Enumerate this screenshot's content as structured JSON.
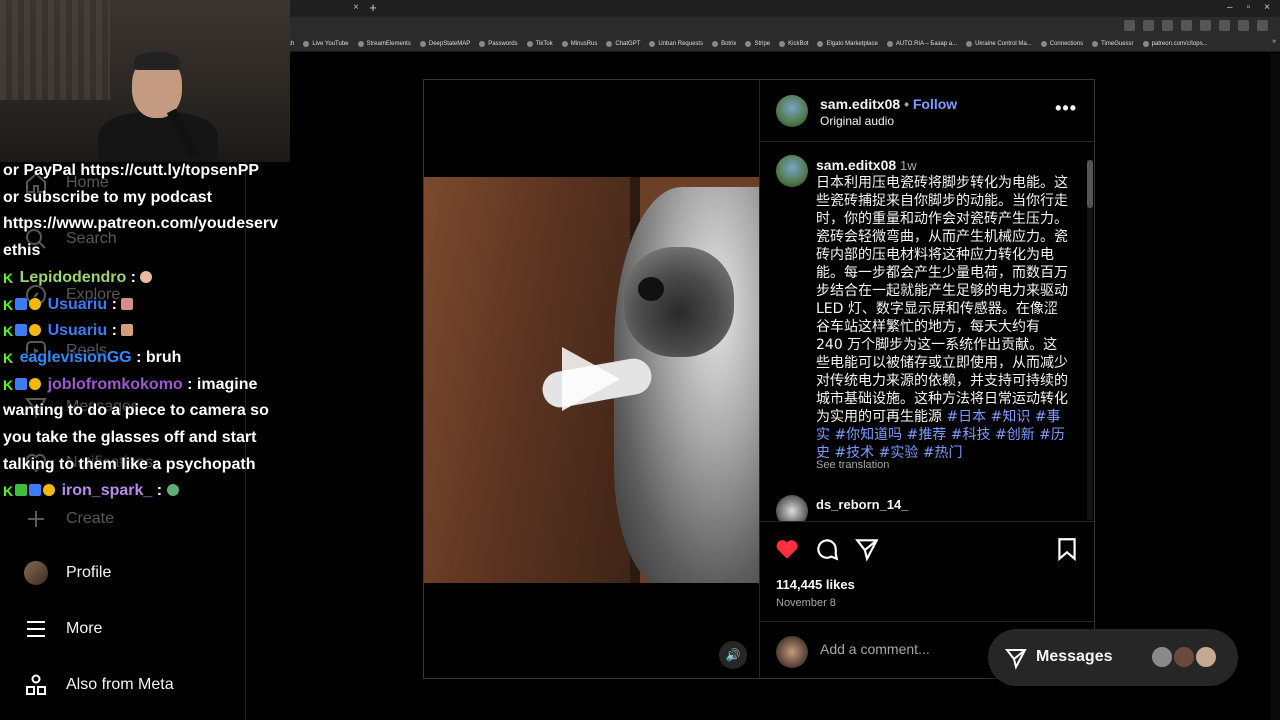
{
  "browser": {
    "tab_close": "×",
    "tab_new": "+",
    "window_controls": [
      "–",
      "▫",
      "×"
    ],
    "bookmarks": [
      "ch",
      "Live YouTube",
      "StreamElements",
      "DeepStateMAP",
      "Passwords",
      "TikTok",
      "MinusRus",
      "ChatGPT",
      "Unban Requests",
      "Botrix",
      "Stripe",
      "KickBot",
      "Elgato Marketplace",
      "AUTO.RIA – Базар а...",
      "Ukraine Control Ma...",
      "Connections",
      "TimeGuessr",
      "patreon.com/c/tops..."
    ],
    "bookmarks_overflow": "»"
  },
  "sidebar": {
    "items": [
      {
        "label": "Home",
        "icon": "home-icon"
      },
      {
        "label": "Search",
        "icon": "search-icon"
      },
      {
        "label": "Explore",
        "icon": "compass-icon"
      },
      {
        "label": "Reels",
        "icon": "reels-icon"
      },
      {
        "label": "Messages",
        "icon": "send-icon"
      },
      {
        "label": "Notifications",
        "icon": "heart-icon"
      },
      {
        "label": "Create",
        "icon": "plus-icon"
      },
      {
        "label": "Profile",
        "icon": "avatar"
      },
      {
        "label": "More",
        "icon": "hamburger-icon"
      },
      {
        "label": "Also from Meta",
        "icon": "grid-icon"
      }
    ]
  },
  "chat": {
    "lines": [
      {
        "text": "or PayPal https://cutt.ly/topsenPP"
      },
      {
        "text": "or subscribe to my podcast"
      },
      {
        "text": "https://www.patreon.com/youdeserv"
      },
      {
        "text": "ethis"
      }
    ],
    "messages": [
      {
        "user": "Lepidodendro",
        "user_color": "#9ad66b",
        "text": " : "
      },
      {
        "user": "Usuariu",
        "user_color": "#3d7cf5",
        "text": " : "
      },
      {
        "user": "Usuariu",
        "user_color": "#3d7cf5",
        "text": " : "
      },
      {
        "user": "eaglevisionGG",
        "user_color": "#2e8bff",
        "text": " : bruh"
      },
      {
        "user": "joblofromkokomo",
        "user_color": "#9b59d0",
        "text": " : imagine"
      },
      {
        "user": "iron_spark_",
        "user_color": "#b58ce8",
        "text": " : "
      }
    ],
    "wrap_lines": [
      "wanting to do a piece to camera so",
      "you take the glasses off and start",
      "talking to them like a psychopath"
    ],
    "badge_letter": "K"
  },
  "post": {
    "author": "sam.editx08",
    "separator": "•",
    "follow_label": "Follow",
    "audio": "Original audio",
    "more": "•••",
    "caption_time": "1w",
    "caption_text": "日本利用压电瓷砖将脚步转化为电能。这些瓷砖捕捉来自你脚步的动能。当你行走时，你的重量和动作会对瓷砖产生压力。瓷砖会轻微弯曲，从而产生机械应力。瓷砖内部的压电材料将这种应力转化为电能。每一步都会产生少量电荷，而数百万步结合在一起就能产生足够的电力来驱动 LED 灯、数字显示屏和传感器。在像涩谷车站这样繁忙的地方，每天大约有 240 万个脚步为这一系统作出贡献。这些电能可以被储存或立即使用，从而减少对传统电力来源的依赖，并支持可持续的城市基础设施。这种方法将日常运动转化为实用的可再生能源",
    "hashtags": " #日本 #知识 #事实 #你知道吗 #推荐 #科技 #创新 #历史 #技术 #实验 #热门",
    "see_translation": "See translation",
    "comment_user": "ds_reborn_14_",
    "likes": "114,445 likes",
    "date": "November 8",
    "add_comment_placeholder": "Add a comment...",
    "liked": true
  },
  "messages_pill": {
    "label": "Messages"
  },
  "colors": {
    "accent_link": "#7a9cff",
    "like_red": "#ff3040",
    "bg": "#000000",
    "border": "#262626"
  }
}
